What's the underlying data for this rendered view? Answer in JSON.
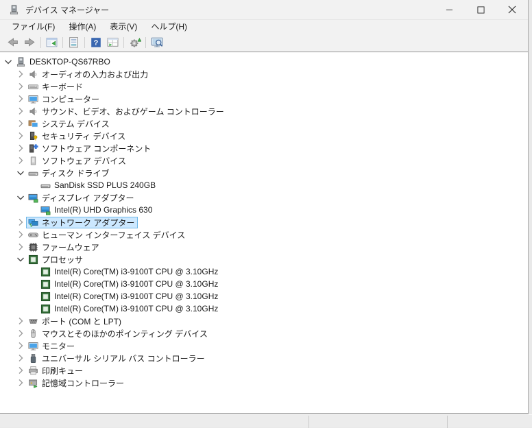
{
  "window": {
    "title": "デバイス マネージャー",
    "controls": [
      "minimize",
      "maximize",
      "close"
    ]
  },
  "menu": {
    "items": [
      {
        "label": "ファイル(F)"
      },
      {
        "label": "操作(A)"
      },
      {
        "label": "表示(V)"
      },
      {
        "label": "ヘルプ(H)"
      }
    ]
  },
  "toolbar": {
    "buttons": [
      "back-icon",
      "forward-icon",
      "show-console-tree-icon",
      "properties-icon",
      "help-icon",
      "action-items-icon",
      "update-driver-icon",
      "scan-hardware-changes-icon"
    ]
  },
  "tree": {
    "items": [
      {
        "label": "DESKTOP-QS67RBO",
        "icon": "computer",
        "level": 0,
        "state": "expanded",
        "selected": false
      },
      {
        "label": "オーディオの入力および出力",
        "icon": "audio-device",
        "level": 1,
        "state": "collapsed",
        "selected": false
      },
      {
        "label": "キーボード",
        "icon": "keyboard",
        "level": 1,
        "state": "collapsed",
        "selected": false
      },
      {
        "label": "コンピューター",
        "icon": "computer-monitor",
        "level": 1,
        "state": "collapsed",
        "selected": false
      },
      {
        "label": "サウンド、ビデオ、およびゲーム コントローラー",
        "icon": "audio-device",
        "level": 1,
        "state": "collapsed",
        "selected": false
      },
      {
        "label": "システム デバイス",
        "icon": "system-device",
        "level": 1,
        "state": "collapsed",
        "selected": false
      },
      {
        "label": "セキュリティ デバイス",
        "icon": "security-device",
        "level": 1,
        "state": "collapsed",
        "selected": false
      },
      {
        "label": "ソフトウェア コンポーネント",
        "icon": "software-component",
        "level": 1,
        "state": "collapsed",
        "selected": false
      },
      {
        "label": "ソフトウェア デバイス",
        "icon": "software-device",
        "level": 1,
        "state": "collapsed",
        "selected": false
      },
      {
        "label": "ディスク ドライブ",
        "icon": "disk-drive",
        "level": 1,
        "state": "expanded",
        "selected": false
      },
      {
        "label": "SanDisk SSD PLUS 240GB",
        "icon": "disk-drive",
        "level": 2,
        "state": "none",
        "selected": false
      },
      {
        "label": "ディスプレイ アダプター",
        "icon": "display-adapter",
        "level": 1,
        "state": "expanded",
        "selected": false
      },
      {
        "label": "Intel(R) UHD Graphics 630",
        "icon": "display-adapter",
        "level": 2,
        "state": "none",
        "selected": false
      },
      {
        "label": "ネットワーク アダプター",
        "icon": "network-adapter",
        "level": 1,
        "state": "collapsed",
        "selected": true
      },
      {
        "label": "ヒューマン インターフェイス デバイス",
        "icon": "hid",
        "level": 1,
        "state": "collapsed",
        "selected": false
      },
      {
        "label": "ファームウェア",
        "icon": "firmware",
        "level": 1,
        "state": "collapsed",
        "selected": false
      },
      {
        "label": "プロセッサ",
        "icon": "processor",
        "level": 1,
        "state": "expanded",
        "selected": false
      },
      {
        "label": "Intel(R) Core(TM) i3-9100T CPU @ 3.10GHz",
        "icon": "processor",
        "level": 2,
        "state": "none",
        "selected": false
      },
      {
        "label": "Intel(R) Core(TM) i3-9100T CPU @ 3.10GHz",
        "icon": "processor",
        "level": 2,
        "state": "none",
        "selected": false
      },
      {
        "label": "Intel(R) Core(TM) i3-9100T CPU @ 3.10GHz",
        "icon": "processor",
        "level": 2,
        "state": "none",
        "selected": false
      },
      {
        "label": "Intel(R) Core(TM) i3-9100T CPU @ 3.10GHz",
        "icon": "processor",
        "level": 2,
        "state": "none",
        "selected": false
      },
      {
        "label": "ポート (COM と LPT)",
        "icon": "port",
        "level": 1,
        "state": "collapsed",
        "selected": false
      },
      {
        "label": "マウスとそのほかのポインティング デバイス",
        "icon": "mouse",
        "level": 1,
        "state": "collapsed",
        "selected": false
      },
      {
        "label": "モニター",
        "icon": "monitor",
        "level": 1,
        "state": "collapsed",
        "selected": false
      },
      {
        "label": "ユニバーサル シリアル バス コントローラー",
        "icon": "usb-controller",
        "level": 1,
        "state": "collapsed",
        "selected": false
      },
      {
        "label": "印刷キュー",
        "icon": "print-queue",
        "level": 1,
        "state": "collapsed",
        "selected": false
      },
      {
        "label": "記憶域コントローラー",
        "icon": "storage-controller",
        "level": 1,
        "state": "collapsed",
        "selected": false
      }
    ]
  },
  "colors": {
    "selection_fill": "#cce8ff",
    "selection_border": "#70b8e8",
    "help_icon_blue": "#3a67b0",
    "accent_green": "#3fae49",
    "chrome_bg": "#f2f2f2",
    "tree_bg": "#ffffff",
    "desktop_bg": "#e9e9e9"
  }
}
